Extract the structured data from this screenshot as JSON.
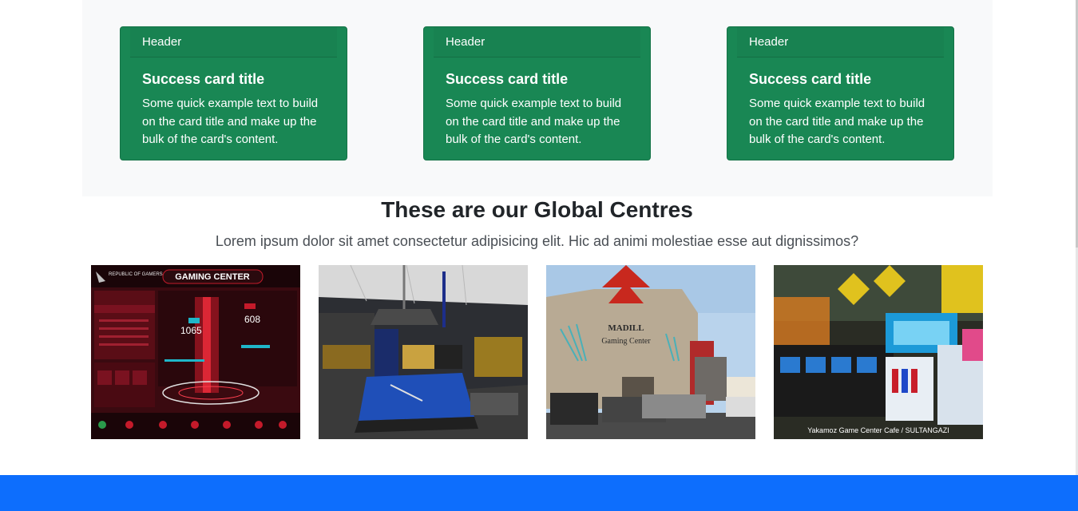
{
  "cards": [
    {
      "header": "Header",
      "title": "Success card title",
      "text": "Some quick example text to build on the card title and make up the bulk of the card's content."
    },
    {
      "header": "Header",
      "title": "Success card title",
      "text": "Some quick example text to build on the card title and make up the bulk of the card's content."
    },
    {
      "header": "Header",
      "title": "Success card title",
      "text": "Some quick example text to build on the card title and make up the bulk of the card's content."
    }
  ],
  "centres": {
    "title": "These are our Global Centres",
    "lead": "Lorem ipsum dolor sit amet consectetur adipisicing elit. Hic ad animi molestiae esse aut dignissimos?",
    "images": [
      {
        "title": "GAMING CENTER",
        "brand": "REPUBLIC OF GAMERS",
        "readout_a": "1065",
        "readout_b": "608"
      },
      {
        "subject": "billiard lounge"
      },
      {
        "sign_line1": "MADILL",
        "sign_line2": "Gaming Center"
      },
      {
        "caption": "Yakamoz Game Center Cafe / SULTANGAZI"
      }
    ]
  },
  "colors": {
    "success": "#198754",
    "primary": "#0d6efd",
    "light": "#f8f9fa"
  }
}
